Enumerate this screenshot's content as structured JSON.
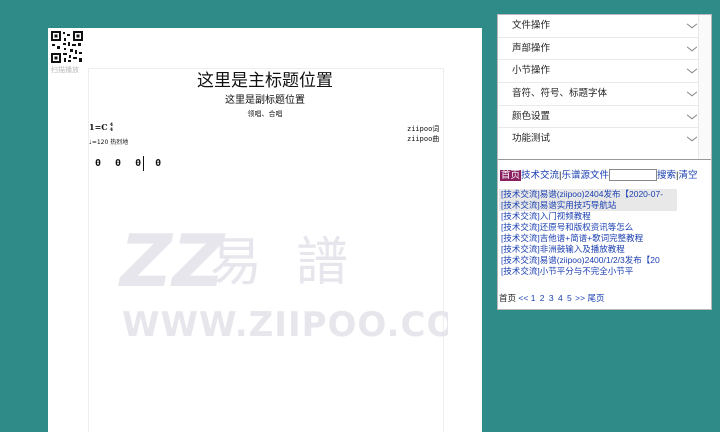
{
  "score": {
    "qr_caption": "扫描播放",
    "main_title": "这里是主标题位置",
    "sub_title": "这里是副标题位置",
    "performer": "领唱、合唱",
    "key": "1=C",
    "time_sig_top": "4",
    "time_sig_bottom": "4",
    "tempo": "♩=120 热烈地",
    "lyricist": "ziipoo词",
    "composer": "ziipoo曲",
    "notes": "0 0 0 0",
    "watermark_brand": "ZZ易 譜",
    "watermark_url": "WWW.ZIIPOO.COM"
  },
  "panel": {
    "menu": [
      "文件操作",
      "声部操作",
      "小节操作",
      "音符、符号、标题字体",
      "颜色设置",
      "功能测试"
    ],
    "search": {
      "home_label": "首页",
      "tech_link": "技术交流",
      "score_link": "乐谱源文件",
      "input_value": "",
      "search_button": "搜索",
      "clear_button": "清空",
      "separator": "|"
    },
    "topics": [
      "[技术交流]易谱(ziipoo)2404发布【2020-07-",
      "[技术交流]易谱实用技巧导航站",
      "[技术交流]入门视频教程",
      "[技术交流]还原号和版权资讯等怎么",
      "[技术交流]吉他谱+简谱+歌词完整教程",
      "[技术交流]非洲鼓输入及播放教程",
      "[技术交流]易谱(ziipoo)2400/1/2/3发布【20",
      "[技术交流]小节平分与不完全小节平"
    ],
    "pager": {
      "first": "首页",
      "prev": "<<",
      "pages": "1 2 3 4 5",
      "next": ">>",
      "last": "尾页"
    }
  },
  "colors": {
    "background": "#2e8b87",
    "link": "#1a3fb0",
    "home_badge": "#8a2060"
  }
}
